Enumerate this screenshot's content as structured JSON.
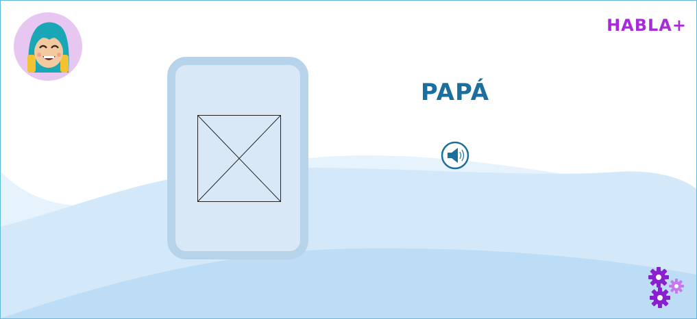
{
  "app": {
    "logo_text": "HABLA+"
  },
  "card": {
    "word": "PAPÁ",
    "image_icon": "image-placeholder-icon"
  },
  "controls": {
    "audio_icon": "speaker-icon",
    "settings_icon": "gears-icon",
    "avatar_icon": "user-avatar-icon"
  },
  "colors": {
    "accent": "#a82ad8",
    "word": "#1b6f9e",
    "card_border": "#b7d3ea",
    "card_fill": "#d8e8f6",
    "wave_light": "#e3f1fb",
    "wave_mid": "#cfe6f8",
    "wave_dark": "#b9dcf6"
  }
}
